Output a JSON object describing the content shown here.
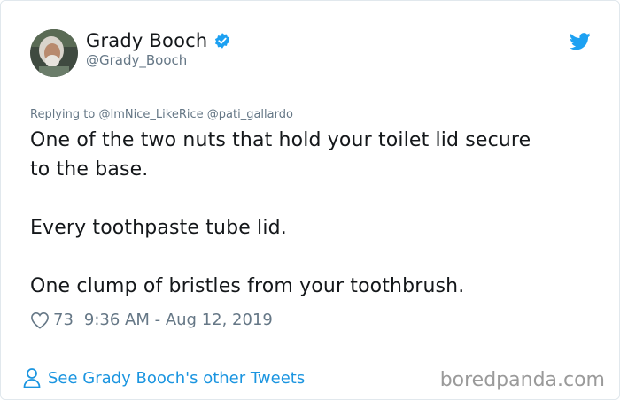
{
  "author": {
    "name": "Grady Booch",
    "handle": "@Grady_Booch",
    "verified": true,
    "avatar_icon": "profile-photo"
  },
  "reply": {
    "prefix": "Replying to",
    "mentions": [
      "@ImNice_LikeRice",
      "@pati_gallardo"
    ]
  },
  "tweet": {
    "lines": [
      "One of the two nuts that hold your toilet lid secure",
      "to the base.",
      "Every toothpaste tube lid.",
      "One clump of bristles from your toothbrush."
    ]
  },
  "meta": {
    "likes": "73",
    "timestamp": "9:36 AM - Aug 12, 2019"
  },
  "footer": {
    "link_label": "See Grady Booch's other Tweets"
  },
  "watermark": "boredpanda.com",
  "colors": {
    "twitter_blue": "#1da1f2",
    "link_blue": "#1b95e0",
    "text": "#14171a",
    "secondary": "#657786"
  }
}
